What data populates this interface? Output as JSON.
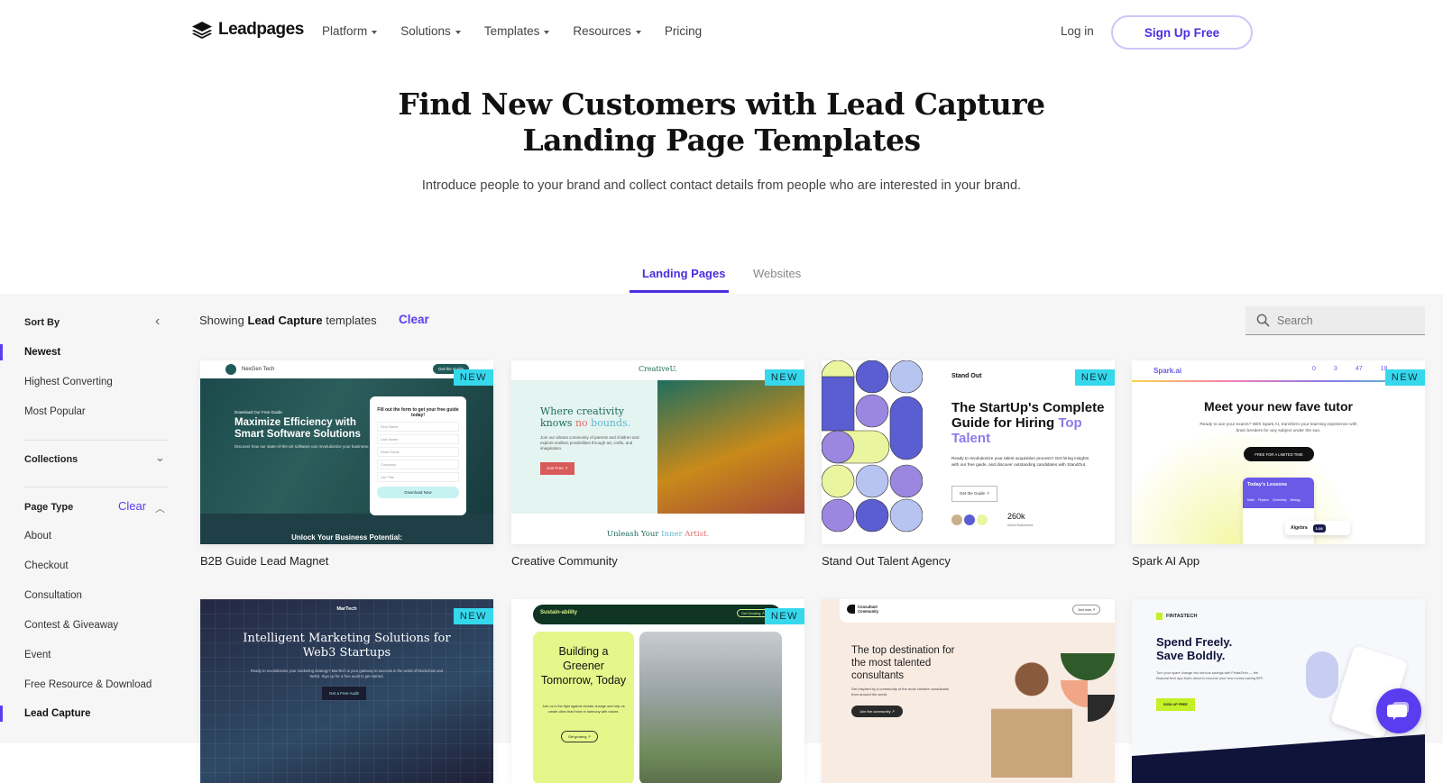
{
  "nav": {
    "logo_text": "Leadpages",
    "menu": [
      {
        "label": "Platform",
        "has_dropdown": true
      },
      {
        "label": "Solutions",
        "has_dropdown": true
      },
      {
        "label": "Templates",
        "has_dropdown": true
      },
      {
        "label": "Resources",
        "has_dropdown": true
      },
      {
        "label": "Pricing",
        "has_dropdown": false
      }
    ],
    "login": "Log in",
    "signup": "Sign Up Free"
  },
  "hero": {
    "title_line1": "Find New Customers with Lead Capture",
    "title_line2": "Landing Page Templates",
    "subtitle": "Introduce people to your brand and collect contact details from people who are interested in your brand."
  },
  "tabs": [
    {
      "label": "Landing Pages",
      "active": true
    },
    {
      "label": "Websites",
      "active": false
    }
  ],
  "sidebar": {
    "sort_by": {
      "heading": "Sort By",
      "items": [
        {
          "label": "Newest",
          "selected": true
        },
        {
          "label": "Highest Converting",
          "selected": false
        },
        {
          "label": "Most Popular",
          "selected": false
        }
      ]
    },
    "collections": {
      "heading": "Collections"
    },
    "page_type": {
      "heading": "Page Type",
      "clear": "Clear",
      "items": [
        {
          "label": "About",
          "selected": false
        },
        {
          "label": "Checkout",
          "selected": false
        },
        {
          "label": "Consultation",
          "selected": false
        },
        {
          "label": "Contest & Giveaway",
          "selected": false
        },
        {
          "label": "Event",
          "selected": false
        },
        {
          "label": "Free Resource & Download",
          "selected": false
        },
        {
          "label": "Lead Capture",
          "selected": true
        }
      ]
    }
  },
  "results": {
    "showing_prefix": "Showing",
    "filter": "Lead Capture",
    "showing_suffix": "templates",
    "clear": "Clear",
    "search_placeholder": "Search"
  },
  "badge_label": "NEW",
  "templates": [
    {
      "name": "B2B Guide Lead Magnet",
      "new": true,
      "preview": {
        "brand": "NexGen Tech",
        "cta_top": "Get the Guide",
        "kicker": "Download Our Free Guide:",
        "headline": "Maximize Efficiency with Smart Software Solutions",
        "body": "Discover how our state-of-the-art software can revolutionize your business.",
        "form_title": "Fill out the form to get your free guide today!",
        "fields": [
          "First Name",
          "Last Name",
          "Work Email",
          "Company",
          "Job Title"
        ],
        "form_button": "Download Now",
        "footer": "Unlock Your Business Potential:"
      }
    },
    {
      "name": "Creative Community",
      "new": true,
      "preview": {
        "brand": "CreativeU.",
        "headline_a": "Where creativity",
        "headline_b": "knows",
        "headline_c": "no",
        "headline_d": "bounds.",
        "body": "Join our vibrant community of parents and children and explore endless possibilities through art, crafts, and imagination.",
        "button": "Join Free ↗",
        "footer_a": "Unleash Your",
        "footer_b": "Inner",
        "footer_c": "Artist."
      }
    },
    {
      "name": "Stand Out Talent Agency",
      "new": true,
      "preview": {
        "brand": "Stand Out",
        "headline": "The StartUp's Complete Guide for Hiring",
        "highlight": "Top Talent",
        "body": "Ready to revolutionize your talent acquisition process? Get hiring insights with our free guide, and discover outstanding candidates with StandOut.",
        "button": "Get the Guide ↗",
        "stat": "260k",
        "stat_label": "Active Businesses"
      }
    },
    {
      "name": "Spark AI App",
      "new": true,
      "preview": {
        "brand": "Spark.ai",
        "counters": [
          "0",
          "3",
          "47",
          "18"
        ],
        "headline": "Meet your new fave tutor",
        "body": "Ready to ace your exams? With Spark.AI, transform your learning experience with brain benders for any subject under the sun.",
        "button": "FREE FOR A LIMITED TIME",
        "app_title": "Today's Lessons",
        "app_tabs": [
          "Math",
          "Physics",
          "Chemistry",
          "Biology"
        ],
        "chip": "Algebra",
        "timer": "1:28"
      }
    },
    {
      "name": "",
      "new": true,
      "preview": {
        "brand": "MarTech",
        "headline": "Intelligent Marketing Solutions for Web3 Startups",
        "body": "Ready to revolutionize your marketing strategy? MarTech is your gateway to success in the world of blockchain and Web3. Sign up for a free audit to get started.",
        "button": "Get a Free Audit"
      }
    },
    {
      "name": "",
      "new": true,
      "preview": {
        "brand": "Sustain-ability",
        "cta_top": "Get Growing ↗",
        "headline": "Building a Greener Tomorrow, Today",
        "body": "Join us in the fight against climate change and help us create cities that thrive in harmony with nature.",
        "button": "Get growing ↗"
      }
    },
    {
      "name": "",
      "new": false,
      "preview": {
        "brand": "Consultant Community",
        "cta_top": "Join now ↗",
        "headline": "The top destination for the most talented consultants",
        "body": "Get inspired by a community of the most creative consultants from around the world.",
        "button": "Join the community ↗"
      }
    },
    {
      "name": "",
      "new": false,
      "preview": {
        "brand": "FINTASTECH",
        "headline": "Spend Freely. Save Boldly.",
        "body": "Turn your spare change into serious savings with FintasTech — the financial tech app that's about to become your new money-saving BFF.",
        "button": "SIGN UP FREE"
      }
    }
  ],
  "colors": {
    "accent": "#5b3df0",
    "badge": "#36d8ec",
    "sidebar_bg": "#f6f6f6"
  }
}
